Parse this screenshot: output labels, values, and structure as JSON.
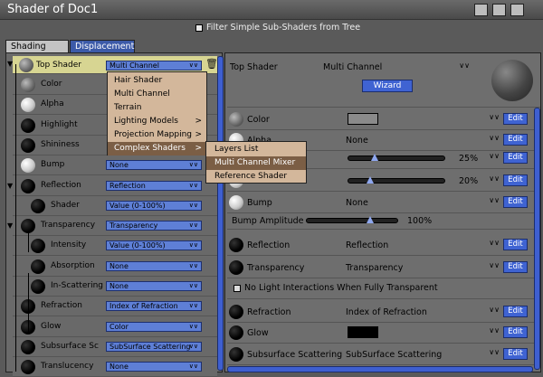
{
  "window": {
    "title": "Shader of Doc1"
  },
  "filter": {
    "label": "Filter Simple Sub-Shaders from Tree"
  },
  "tabs": [
    {
      "label": "Shading"
    },
    {
      "label": "Displacement"
    }
  ],
  "left": {
    "top": {
      "label": "Top Shader",
      "value": "Multi Channel"
    },
    "rows": [
      {
        "label": "Color",
        "value": ""
      },
      {
        "label": "Alpha",
        "value": ""
      },
      {
        "label": "Highlight",
        "value": ""
      },
      {
        "label": "Shininess",
        "value": ""
      },
      {
        "label": "Bump",
        "value": "None"
      },
      {
        "label": "Reflection",
        "value": "Reflection"
      },
      {
        "label": "Shader",
        "value": "Value (0-100%)"
      },
      {
        "label": "Transparency",
        "value": "Transparency"
      },
      {
        "label": "Intensity",
        "value": "Value (0-100%)"
      },
      {
        "label": "Absorption",
        "value": "None"
      },
      {
        "label": "In-Scattering",
        "value": "None"
      },
      {
        "label": "Refraction",
        "value": "Index of Refraction"
      },
      {
        "label": "Glow",
        "value": "Color"
      },
      {
        "label": "Subsurface Sc",
        "value": "SubSurface Scattering"
      },
      {
        "label": "Translucency",
        "value": "None"
      }
    ]
  },
  "menu": {
    "items": [
      {
        "label": "Hair Shader",
        "arrow": ""
      },
      {
        "label": "Multi Channel",
        "arrow": ""
      },
      {
        "label": "Terrain",
        "arrow": ""
      },
      {
        "label": "Lighting Models",
        "arrow": ">"
      },
      {
        "label": "Projection Mapping",
        "arrow": ">"
      },
      {
        "label": "Complex Shaders",
        "arrow": ">"
      }
    ],
    "sub": [
      {
        "label": "Layers List"
      },
      {
        "label": "Multi Channel Mixer"
      },
      {
        "label": "Reference Shader"
      }
    ]
  },
  "right": {
    "top_label": "Top Shader",
    "top_value": "Multi Channel",
    "wizard": "Wizard",
    "edit": "Edit",
    "rows": [
      {
        "label": "Color",
        "value": ""
      },
      {
        "label": "Alpha",
        "value": "None"
      },
      {
        "label": "",
        "value": "25%",
        "level": 0.25
      },
      {
        "label": "",
        "value": "20%",
        "level": 0.2
      },
      {
        "label": "Bump",
        "value": "None"
      },
      {
        "label": "Reflection",
        "value": "Reflection"
      },
      {
        "label": "Transparency",
        "value": "Transparency"
      },
      {
        "label": "Refraction",
        "value": "Index of Refraction"
      },
      {
        "label": "Glow",
        "value": ""
      },
      {
        "label": "Subsurface Scattering",
        "value": "SubSurface Scattering"
      }
    ],
    "bump_amp": {
      "label": "Bump Amplitude",
      "value": "100%",
      "level": 1.0
    },
    "nolight": {
      "label": "No Light Interactions When Fully Transparent"
    }
  },
  "colors": {
    "color_swatch": "#8a8a8a",
    "glow_swatch": "#000000",
    "accent": "#3f63d2"
  }
}
